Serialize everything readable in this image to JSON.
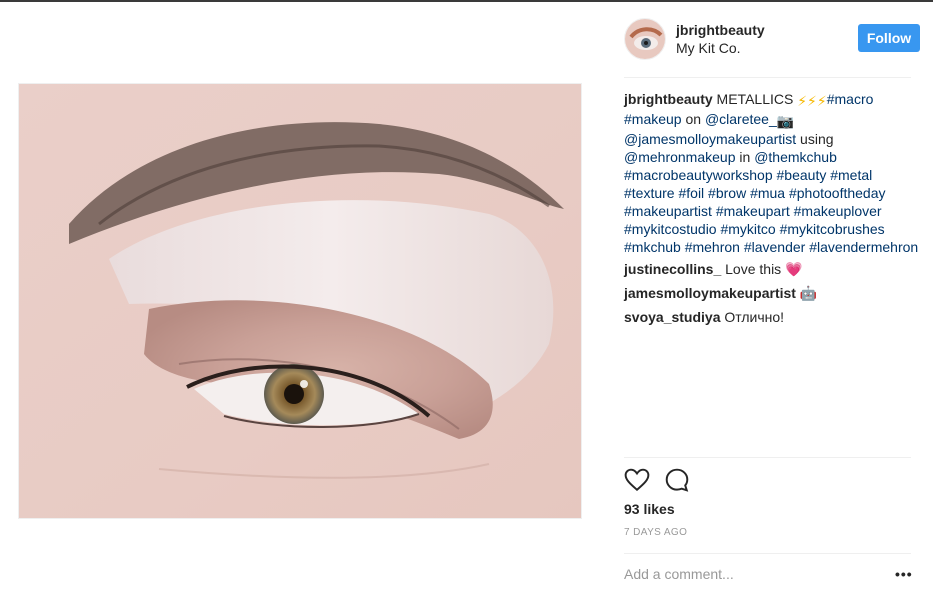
{
  "post": {
    "username": "jbrightbeauty",
    "location": "My Kit Co.",
    "follow_label": "Follow",
    "caption": {
      "username": "jbrightbeauty",
      "segments": [
        {
          "text": " METALLICS ",
          "tag": false
        },
        {
          "text": "⚡⚡⚡",
          "tag": false,
          "emoji": "lightning-emoji"
        },
        {
          "text": "#macro #makeup",
          "tag": true
        },
        {
          "text": " on ",
          "tag": false
        },
        {
          "text": "@claretee_",
          "tag": true
        },
        {
          "text": " 📷 ",
          "tag": false,
          "emoji": "camera-emoji"
        },
        {
          "text": "@jamesmolloymakeupartist",
          "tag": true
        },
        {
          "text": " using ",
          "tag": false
        },
        {
          "text": "@mehronmakeup",
          "tag": true
        },
        {
          "text": " in ",
          "tag": false
        },
        {
          "text": "@themkchub #macrobeautyworkshop #beauty #metal #texture #foil #brow #mua #photooftheday #makeupartist #makeupart #makeuplover #mykitcostudio #mykitco #mykitcobrushes #mkchub #mehron #lavender #lavendermehron",
          "tag": true
        }
      ]
    },
    "comments": [
      {
        "username": "justinecollins_",
        "text": " Love this 💗"
      },
      {
        "username": "jamesmolloymakeupartist",
        "text": " 🤖"
      },
      {
        "username": "svoya_studiya",
        "text": " Отлично!"
      }
    ],
    "likes": "93 likes",
    "date": "7 DAYS AGO",
    "comment_placeholder": "Add a comment...",
    "more_label": "•••",
    "icons": {
      "like": "heart-icon",
      "comment": "speech-bubble-icon",
      "more": "ellipsis-icon"
    },
    "colors": {
      "follow_button": "#3897f0",
      "tag": "#003569",
      "muted": "#999999"
    }
  }
}
